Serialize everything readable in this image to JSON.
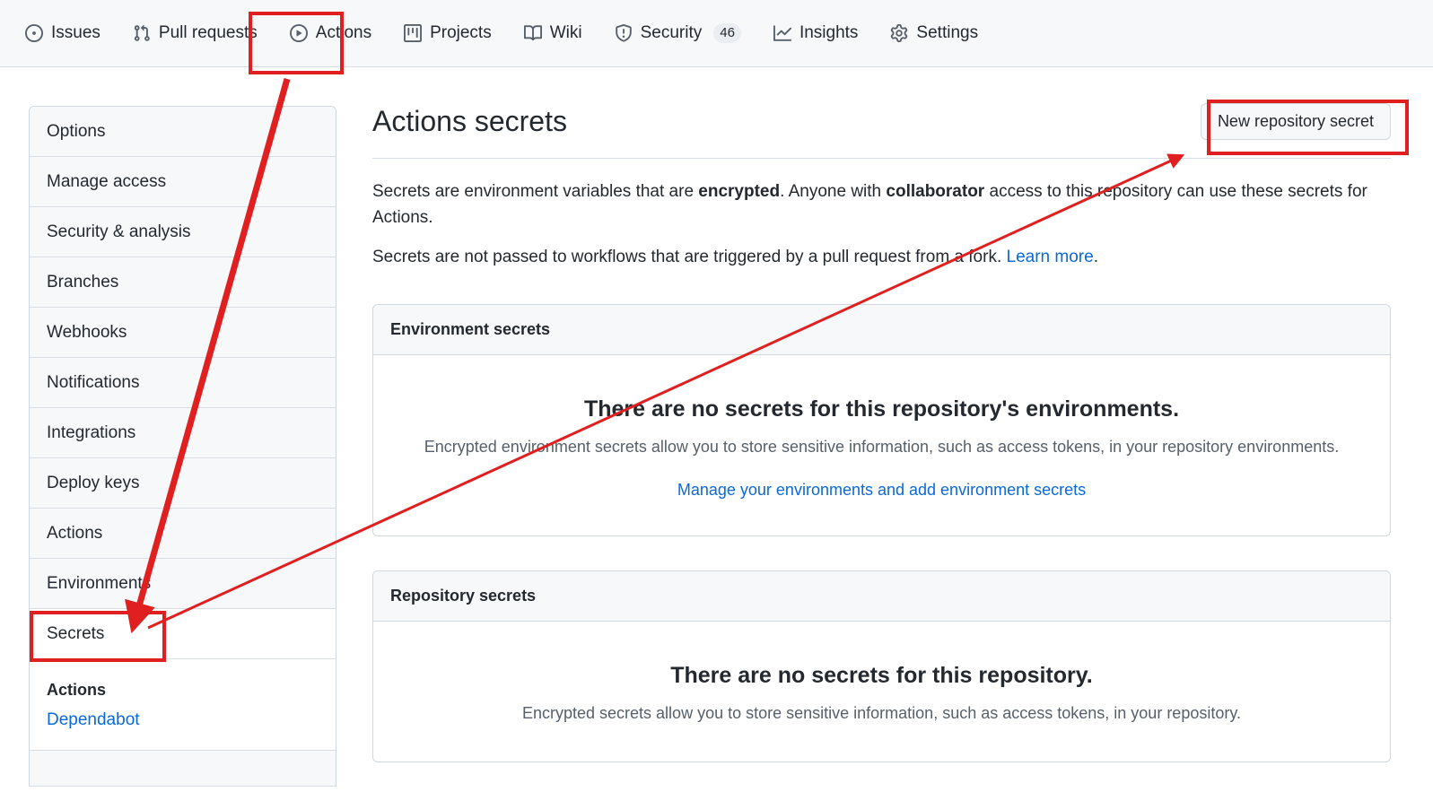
{
  "repo_nav": {
    "items": [
      {
        "label": "Issues",
        "icon": "issue-opened-icon",
        "count": null
      },
      {
        "label": "Pull requests",
        "icon": "git-pull-request-icon",
        "count": null
      },
      {
        "label": "Actions",
        "icon": "play-circle-icon",
        "count": null
      },
      {
        "label": "Projects",
        "icon": "project-board-icon",
        "count": null
      },
      {
        "label": "Wiki",
        "icon": "book-icon",
        "count": null
      },
      {
        "label": "Security",
        "icon": "shield-alert-icon",
        "count": "46"
      },
      {
        "label": "Insights",
        "icon": "graph-icon",
        "count": null
      },
      {
        "label": "Settings",
        "icon": "gear-icon",
        "count": null
      }
    ]
  },
  "sidebar": {
    "items": [
      {
        "label": "Options"
      },
      {
        "label": "Manage access"
      },
      {
        "label": "Security & analysis"
      },
      {
        "label": "Branches"
      },
      {
        "label": "Webhooks"
      },
      {
        "label": "Notifications"
      },
      {
        "label": "Integrations"
      },
      {
        "label": "Deploy keys"
      },
      {
        "label": "Actions"
      },
      {
        "label": "Environments"
      },
      {
        "label": "Secrets"
      }
    ],
    "sub": {
      "title": "Actions",
      "link": "Dependabot"
    }
  },
  "main": {
    "title": "Actions secrets",
    "new_secret_button": "New repository secret",
    "intro": {
      "line1_a": "Secrets are environment variables that are ",
      "line1_b": "encrypted",
      "line1_c": ". Anyone with ",
      "line1_d": "collaborator",
      "line1_e": " access to this repository can use these secrets for Actions.",
      "line2_a": "Secrets are not passed to workflows that are triggered by a pull request from a fork. ",
      "line2_link": "Learn more",
      "line2_b": "."
    },
    "environment_box": {
      "header": "Environment secrets",
      "blank_title": "There are no secrets for this repository's environments.",
      "blank_text": "Encrypted environment secrets allow you to store sensitive information, such as access tokens, in your repository environments.",
      "blank_link": "Manage your environments and add environment secrets"
    },
    "repository_box": {
      "header": "Repository secrets",
      "blank_title": "There are no secrets for this repository.",
      "blank_text": "Encrypted secrets allow you to store sensitive information, such as access tokens, in your repository."
    }
  },
  "annotations": {
    "color": "#e02020",
    "boxes": [
      {
        "name": "actions-tab-highlight"
      },
      {
        "name": "new-repository-secret-highlight"
      },
      {
        "name": "secrets-sidebar-highlight"
      }
    ],
    "arrows": [
      {
        "name": "actions-tab-to-secrets-arrow"
      },
      {
        "name": "secrets-to-new-secret-button-arrow"
      }
    ]
  }
}
